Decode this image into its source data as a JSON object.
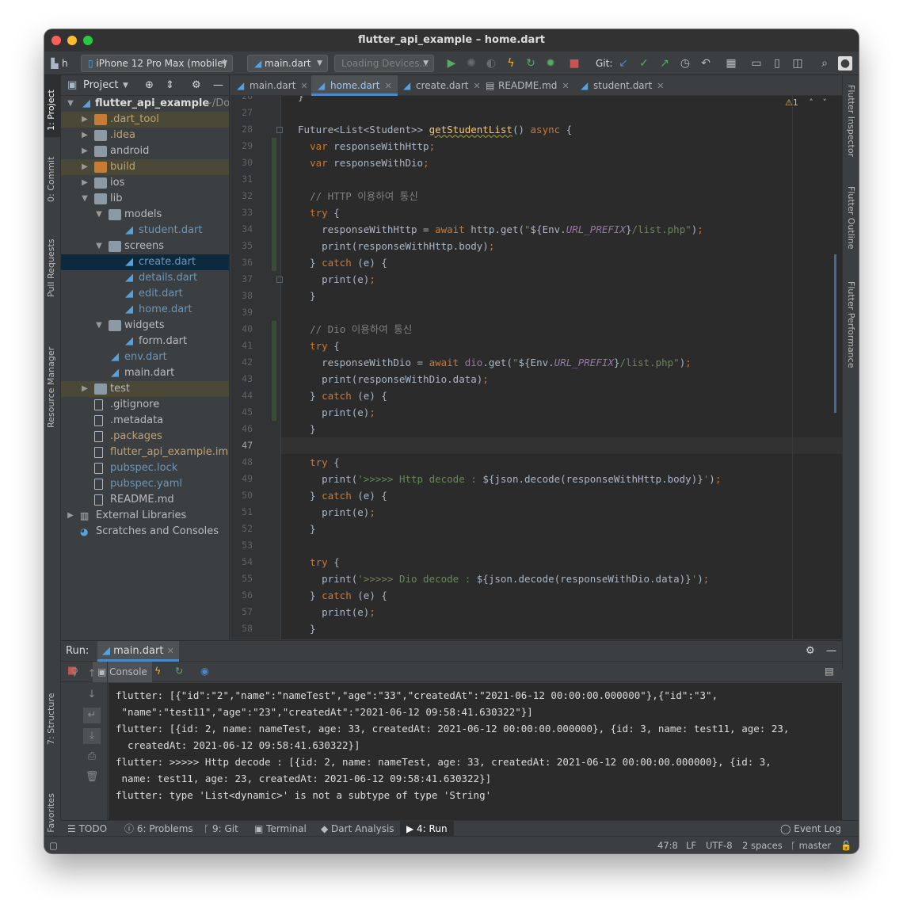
{
  "window": {
    "title": "flutter_api_example – home.dart"
  },
  "toolbar": {
    "project_initial": "h",
    "device": "iPhone 12 Pro Max (mobile)",
    "config": "main.dart",
    "devices_loading": "Loading Devices...",
    "git_label": "Git:"
  },
  "left_stripe": {
    "project": "1: Project",
    "commit": "0: Commit",
    "pull_requests": "Pull Requests",
    "resource_manager": "Resource Manager",
    "structure": "7: Structure",
    "favorites": "2: Favorites"
  },
  "right_stripe": {
    "inspector": "Flutter Inspector",
    "outline": "Flutter Outline",
    "performance": "Flutter Performance"
  },
  "project_panel": {
    "title": "Project",
    "root": "flutter_api_example",
    "root_path": "~/Doc",
    "items": [
      {
        "label": ".dart_tool",
        "depth": 1,
        "kind": "folder-orange",
        "chev": "right",
        "color": "#c2a26a",
        "excluded": true
      },
      {
        "label": ".idea",
        "depth": 1,
        "kind": "folder",
        "chev": "right",
        "color": "#c2a26a"
      },
      {
        "label": "android",
        "depth": 1,
        "kind": "folder",
        "chev": "right",
        "color": "#bbbbbb"
      },
      {
        "label": "build",
        "depth": 1,
        "kind": "folder-orange",
        "chev": "right",
        "color": "#c2a26a",
        "excluded": true
      },
      {
        "label": "ios",
        "depth": 1,
        "kind": "folder",
        "chev": "right",
        "color": "#bbbbbb"
      },
      {
        "label": "lib",
        "depth": 1,
        "kind": "folder",
        "chev": "down",
        "color": "#bbbbbb"
      },
      {
        "label": "models",
        "depth": 2,
        "kind": "folder",
        "chev": "down",
        "color": "#bbbbbb"
      },
      {
        "label": "student.dart",
        "depth": 3,
        "kind": "dart",
        "color": "#6897bb"
      },
      {
        "label": "screens",
        "depth": 2,
        "kind": "folder",
        "chev": "down",
        "color": "#bbbbbb"
      },
      {
        "label": "create.dart",
        "depth": 3,
        "kind": "dart",
        "color": "#6897bb",
        "selected": true
      },
      {
        "label": "details.dart",
        "depth": 3,
        "kind": "dart",
        "color": "#6897bb"
      },
      {
        "label": "edit.dart",
        "depth": 3,
        "kind": "dart",
        "color": "#6897bb"
      },
      {
        "label": "home.dart",
        "depth": 3,
        "kind": "dart",
        "color": "#6897bb"
      },
      {
        "label": "widgets",
        "depth": 2,
        "kind": "folder",
        "chev": "down",
        "color": "#bbbbbb"
      },
      {
        "label": "form.dart",
        "depth": 3,
        "kind": "dart",
        "color": "#bbbbbb"
      },
      {
        "label": "env.dart",
        "depth": 2,
        "kind": "dart",
        "color": "#6897bb"
      },
      {
        "label": "main.dart",
        "depth": 2,
        "kind": "dart",
        "color": "#bbbbbb"
      },
      {
        "label": "test",
        "depth": 1,
        "kind": "folder",
        "chev": "right",
        "color": "#bbbbbb",
        "excluded": true
      },
      {
        "label": ".gitignore",
        "depth": 1,
        "kind": "file",
        "color": "#bbbbbb"
      },
      {
        "label": ".metadata",
        "depth": 1,
        "kind": "file",
        "color": "#bbbbbb"
      },
      {
        "label": ".packages",
        "depth": 1,
        "kind": "file",
        "color": "#c2a26a"
      },
      {
        "label": "flutter_api_example.iml",
        "depth": 1,
        "kind": "file",
        "color": "#c2a26a"
      },
      {
        "label": "pubspec.lock",
        "depth": 1,
        "kind": "file",
        "color": "#6897bb"
      },
      {
        "label": "pubspec.yaml",
        "depth": 1,
        "kind": "file",
        "color": "#6897bb"
      },
      {
        "label": "README.md",
        "depth": 1,
        "kind": "file",
        "color": "#bbbbbb"
      },
      {
        "label": "External Libraries",
        "depth": 0,
        "kind": "lib",
        "chev": "right",
        "color": "#bbbbbb"
      },
      {
        "label": "Scratches and Consoles",
        "depth": 0,
        "kind": "scratch",
        "color": "#bbbbbb"
      }
    ]
  },
  "tabs": [
    {
      "label": "main.dart",
      "active": false
    },
    {
      "label": "home.dart",
      "active": true
    },
    {
      "label": "create.dart",
      "active": false
    },
    {
      "label": "README.md",
      "active": false
    },
    {
      "label": "student.dart",
      "active": false
    }
  ],
  "editor": {
    "warnings": "1",
    "current_line": "47",
    "lines": [
      {
        "n": "26",
        "html": "}"
      },
      {
        "n": "27",
        "html": ""
      },
      {
        "n": "28",
        "html": "Future&lt;List&lt;Student&gt;&gt; <span class=\"fn-u\">getStudentList</span>() <span class=\"k\">async</span> {"
      },
      {
        "n": "29",
        "html": "  <span class=\"k\">var</span> responseWithHttp<span class=\"k\">;</span>"
      },
      {
        "n": "30",
        "html": "  <span class=\"k\">var</span> responseWithDio<span class=\"k\">;</span>"
      },
      {
        "n": "31",
        "html": ""
      },
      {
        "n": "32",
        "html": "  <span class=\"c\">// HTTP 이용하여 통신</span>"
      },
      {
        "n": "33",
        "html": "  <span class=\"k\">try</span> {"
      },
      {
        "n": "34",
        "html": "    responseWithHttp = <span class=\"k\">await</span> http.get(<span class=\"s\">\"</span>${Env.<span class=\"pu\">URL_PREFIX</span>}<span class=\"s\">/list.php\"</span>)<span class=\"k\">;</span>"
      },
      {
        "n": "35",
        "html": "    print(responseWithHttp.body)<span class=\"k\">;</span>"
      },
      {
        "n": "36",
        "html": "  } <span class=\"k\">catch</span> (e) {"
      },
      {
        "n": "37",
        "html": "    print(e)<span class=\"k\">;</span>"
      },
      {
        "n": "38",
        "html": "  }"
      },
      {
        "n": "39",
        "html": ""
      },
      {
        "n": "40",
        "html": "  <span class=\"c\">// Dio 이용하여 통신</span>"
      },
      {
        "n": "41",
        "html": "  <span class=\"k\">try</span> {"
      },
      {
        "n": "42",
        "html": "    responseWithDio = <span class=\"k\">await</span> <span class=\"pu\" style=\"font-style:normal\">dio</span>.get(<span class=\"s\">\"</span>${Env.<span class=\"pu\">URL_PREFIX</span>}<span class=\"s\">/list.php\"</span>)<span class=\"k\">;</span>"
      },
      {
        "n": "43",
        "html": "    print(responseWithDio.data)<span class=\"k\">;</span>"
      },
      {
        "n": "44",
        "html": "  } <span class=\"k\">catch</span> (e) {"
      },
      {
        "n": "45",
        "html": "    print(e)<span class=\"k\">;</span>"
      },
      {
        "n": "46",
        "html": "  }"
      },
      {
        "n": "47",
        "html": ""
      },
      {
        "n": "48",
        "html": "  <span class=\"k\">try</span> {"
      },
      {
        "n": "49",
        "html": "    print(<span class=\"s\">'&gt;&gt;&gt;&gt;&gt; Http decode : </span>${json.decode(responseWithHttp.body)}<span class=\"s\">'</span>)<span class=\"k\">;</span>"
      },
      {
        "n": "50",
        "html": "  } <span class=\"k\">catch</span> (e) {"
      },
      {
        "n": "51",
        "html": "    print(e)<span class=\"k\">;</span>"
      },
      {
        "n": "52",
        "html": "  }"
      },
      {
        "n": "53",
        "html": ""
      },
      {
        "n": "54",
        "html": "  <span class=\"k\">try</span> {"
      },
      {
        "n": "55",
        "html": "    print(<span class=\"s\">'&gt;&gt;&gt;&gt;&gt; Dio decode : </span>${json.decode(responseWithDio.data)}<span class=\"s\">'</span>)<span class=\"k\">;</span>"
      },
      {
        "n": "56",
        "html": "  } <span class=\"k\">catch</span> (e) {"
      },
      {
        "n": "57",
        "html": "    print(e)<span class=\"k\">;</span>"
      },
      {
        "n": "58",
        "html": "  }"
      }
    ]
  },
  "run": {
    "label": "Run:",
    "tab": "main.dart",
    "console_tab": "Console",
    "output": [
      "flutter: [{\"id\":\"2\",\"name\":\"nameTest\",\"age\":\"33\",\"createdAt\":\"2021-06-12 00:00:00.000000\"},{\"id\":\"3\",",
      " \"name\":\"test11\",\"age\":\"23\",\"createdAt\":\"2021-06-12 09:58:41.630322\"}]",
      "flutter: [{id: 2, name: nameTest, age: 33, createdAt: 2021-06-12 00:00:00.000000}, {id: 3, name: test11, age: 23,",
      "  createdAt: 2021-06-12 09:58:41.630322}]",
      "flutter: >>>>> Http decode : [{id: 2, name: nameTest, age: 33, createdAt: 2021-06-12 00:00:00.000000}, {id: 3,",
      " name: test11, age: 23, createdAt: 2021-06-12 09:58:41.630322}]",
      "flutter: type 'List<dynamic>' is not a subtype of type 'String'"
    ]
  },
  "bottom_tools": [
    {
      "label": "TODO",
      "icon": "list-icon",
      "glyph": "☰"
    },
    {
      "label": "6: Problems",
      "icon": "info-icon",
      "glyph": "ⓘ"
    },
    {
      "label": "9: Git",
      "icon": "git-branch-icon",
      "glyph": "ᚴ"
    },
    {
      "label": "Terminal",
      "icon": "terminal-icon",
      "glyph": "▣"
    },
    {
      "label": "Dart Analysis",
      "icon": "dart-analysis-icon",
      "glyph": "◆"
    },
    {
      "label": "4: Run",
      "icon": "run-icon",
      "glyph": "▶",
      "active": true
    }
  ],
  "event_log": "Event Log",
  "status": {
    "position": "47:8",
    "line_sep": "LF",
    "encoding": "UTF-8",
    "indent": "2 spaces",
    "branch": "master"
  },
  "colors": {
    "accent": "#4a88c7",
    "editor_bg": "#2b2b2b",
    "panel_bg": "#3c3f41",
    "keyword": "#cc7832",
    "string": "#6a8759",
    "function": "#ffc66d"
  }
}
